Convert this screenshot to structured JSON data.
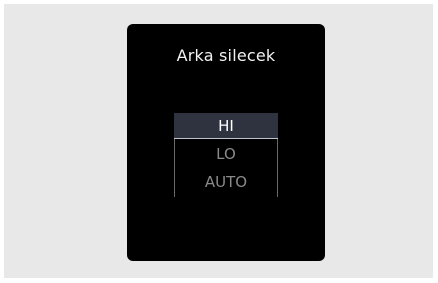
{
  "panel": {
    "title": "Arka silecek"
  },
  "wiper_options": {
    "items": [
      {
        "label": "HI",
        "selected": true
      },
      {
        "label": "LO",
        "selected": false
      },
      {
        "label": "AUTO",
        "selected": false
      }
    ]
  },
  "colors": {
    "background": "#e8e8e8",
    "panel": "#000000",
    "selected_bg": "#2f333f",
    "selected_text": "#ffffff",
    "unselected_text": "#8a8a8a"
  }
}
